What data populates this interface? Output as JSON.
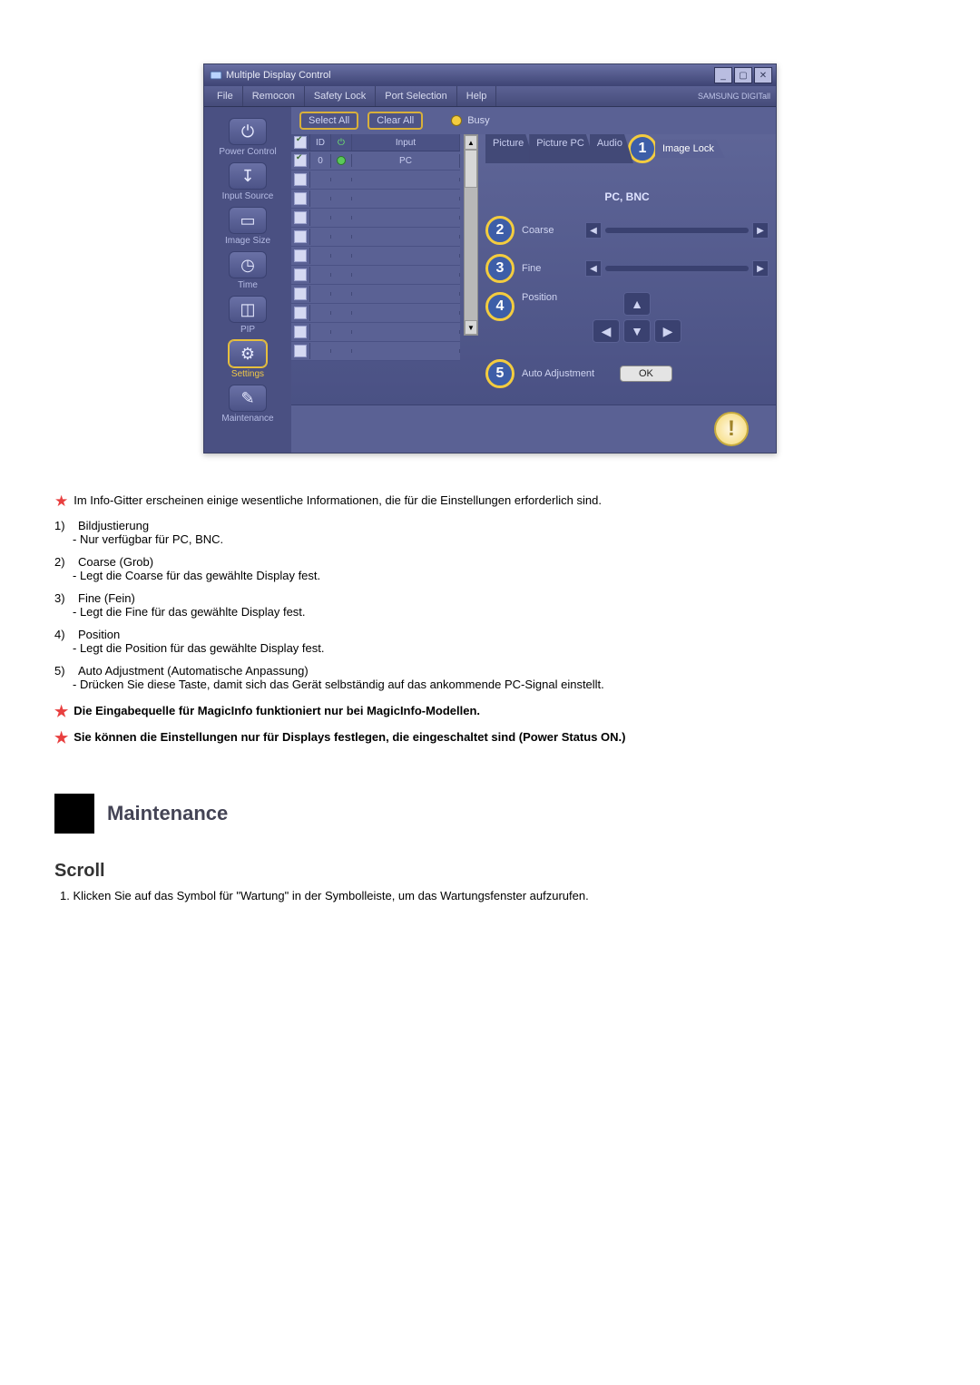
{
  "window": {
    "title": "Multiple Display Control",
    "brand": "SAMSUNG DIGITall"
  },
  "menu": {
    "file": "File",
    "remocon": "Remocon",
    "safety_lock": "Safety Lock",
    "port_selection": "Port Selection",
    "help": "Help"
  },
  "sidebar": {
    "power": "Power Control",
    "input": "Input Source",
    "image": "Image Size",
    "time": "Time",
    "pip": "PIP",
    "settings": "Settings",
    "maintenance": "Maintenance"
  },
  "toolbar": {
    "select_all": "Select All",
    "clear_all": "Clear All",
    "busy": "Busy"
  },
  "grid": {
    "head_id": "ID",
    "head_input": "Input",
    "rows": [
      {
        "id": "0",
        "input": "PC",
        "checked": true
      }
    ],
    "empty_rows": 10
  },
  "tabs": {
    "picture": "Picture",
    "picture_pc": "Picture PC",
    "audio": "Audio",
    "image_lock": "Image Lock"
  },
  "panel": {
    "subtitle": "PC, BNC",
    "coarse": "Coarse",
    "fine": "Fine",
    "position": "Position",
    "auto": "Auto Adjustment",
    "ok": "OK"
  },
  "callouts": {
    "c1": "1",
    "c2": "2",
    "c3": "3",
    "c4": "4",
    "c5": "5"
  },
  "doc": {
    "intro": "Im Info-Gitter erscheinen einige wesentliche Informationen, die für die Einstellungen erforderlich sind.",
    "i1t": "Bildjustierung",
    "i1d": "- Nur verfügbar für PC, BNC.",
    "i2t": "Coarse (Grob)",
    "i2d": "- Legt die Coarse für das gewählte Display fest.",
    "i3t": "Fine (Fein)",
    "i3d": "- Legt die Fine für das gewählte Display fest.",
    "i4t": "Position",
    "i4d": "- Legt die Position für das gewählte Display fest.",
    "i5t": "Auto Adjustment (Automatische Anpassung)",
    "i5d": "- Drücken Sie diese Taste, damit sich das Gerät selbständig auf das ankommende PC-Signal einstellt.",
    "n1": "1)",
    "n2": "2)",
    "n3": "3)",
    "n4": "4)",
    "n5": "5)",
    "note_magic": "Die Eingabequelle für MagicInfo funktioniert nur bei MagicInfo-Modellen.",
    "note_power": "Sie können die Einstellungen nur für Displays festlegen, die eingeschaltet sind (Power Status ON.)",
    "heading": "Maintenance",
    "subheading": "Scroll",
    "scroll_1": "1. Klicken Sie auf das Symbol für \"Wartung\" in der Symbolleiste, um das Wartungsfenster aufzurufen."
  }
}
